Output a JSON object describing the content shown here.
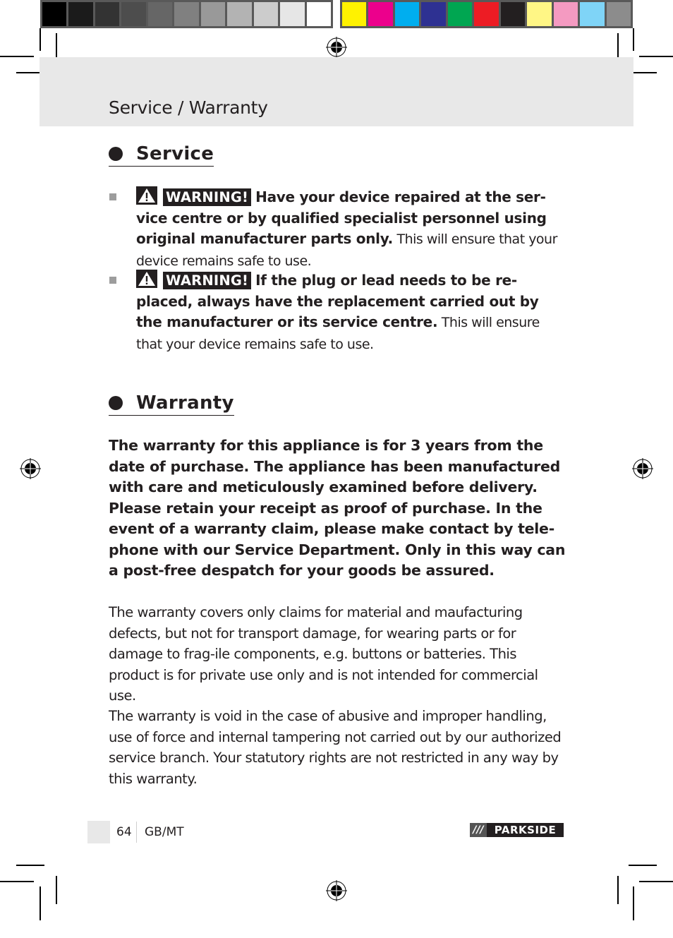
{
  "color_bars": {
    "grayscale": [
      "#000000",
      "#1b1b1b",
      "#333333",
      "#4d4d4d",
      "#666666",
      "#808080",
      "#999999",
      "#b3b3b3",
      "#cccccc",
      "#e6e6e6",
      "#ffffff"
    ],
    "process": [
      "#fff200",
      "#ec008c",
      "#00aeef",
      "#2e3192",
      "#00a651",
      "#ed1c24",
      "#231f20",
      "#fff685",
      "#f49ac1",
      "#7fd4f7",
      "#8c8c8c"
    ]
  },
  "header": {
    "title": "Service / Warranty"
  },
  "service": {
    "heading": "Service",
    "items": [
      {
        "warning_label": "WARNING!",
        "bold": "Have your device repaired at the ser-vice centre or by qualified specialist personnel using original manufacturer parts only.",
        "normal": " This will ensure that your device remains safe to use."
      },
      {
        "warning_label": "WARNING!",
        "bold": "If the plug or lead needs to be re-placed, always have the replacement carried out by the manufacturer or its service centre.",
        "normal": " This will ensure that your device remains safe to use."
      }
    ]
  },
  "warranty": {
    "heading": "Warranty",
    "bold_paragraph": "The warranty for this appliance is for 3 years from the date of purchase. The appliance has been manufactured with care and meticulously examined before delivery. Please retain your receipt as proof of purchase. In the event of a warranty claim, please make contact by tele-phone with our Service Department. Only in this way can a post-free despatch for your goods be assured.",
    "paragraph_2": "The warranty covers only claims for material and maufacturing defects, but not for transport damage, for wearing parts or for damage to frag-ile components, e.g. buttons or batteries. This product is for private use only and is not intended for commercial use.",
    "paragraph_3": "The warranty is void in the case of abusive and improper handling, use of force and internal tampering not carried out by our authorized service branch. Your statutory rights are not  restricted in any way by this warranty."
  },
  "footer": {
    "page_number": "64",
    "language": "GB/MT",
    "logo_slashes": "///",
    "logo_name": "PARKSIDE"
  }
}
